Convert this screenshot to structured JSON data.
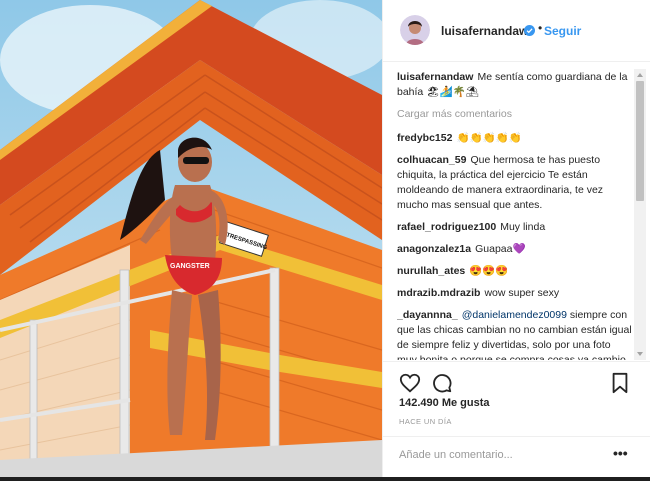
{
  "header": {
    "username": "luisafernandaw",
    "separator": "•",
    "follow_label": "Seguir"
  },
  "caption": {
    "username": "luisafernandaw",
    "text": "Me sentía como guardiana de la bahía 🏖🏄🌴⛱"
  },
  "load_more_label": "Cargar más comentarios",
  "comments": [
    {
      "user": "fredybc152",
      "text": "👏👏👏👏👏"
    },
    {
      "user": "colhuacan_59",
      "text": "Que hermosa te has puesto chiquita, la práctica del ejercicio Te están moldeando de manera extraordinaria, te vez mucho mas sensual que antes."
    },
    {
      "user": "rafael_rodriguez100",
      "text": "Muy linda"
    },
    {
      "user": "anagonzalez1a",
      "text": "Guapaa💜"
    },
    {
      "user": "nurullah_ates",
      "text": "😍😍😍"
    },
    {
      "user": "mdrazib.mdrazib",
      "text": "wow super sexy"
    },
    {
      "user": "_dayannna_",
      "mention": "@danielamendez0099",
      "text": "siempre con que las chicas cambian no no cambian están igual de siempre feliz y divertidas, solo por una foto muy bonita o porque se compra cosas ya cambio pues no."
    }
  ],
  "likes": "142.490 Me gusta",
  "timestamp": "HACE UN DÍA",
  "add_comment_placeholder": "Añade un comentario...",
  "more_options": "•••",
  "photo": {
    "sign_text": "TRESPASSING",
    "suit_text": "GANGSTER"
  },
  "colors": {
    "link": "#3897f0",
    "text": "#262626",
    "muted": "#999999",
    "verified": "#3897f0"
  },
  "icons": [
    "heart-icon",
    "comment-icon",
    "bookmark-icon",
    "verified-icon"
  ]
}
